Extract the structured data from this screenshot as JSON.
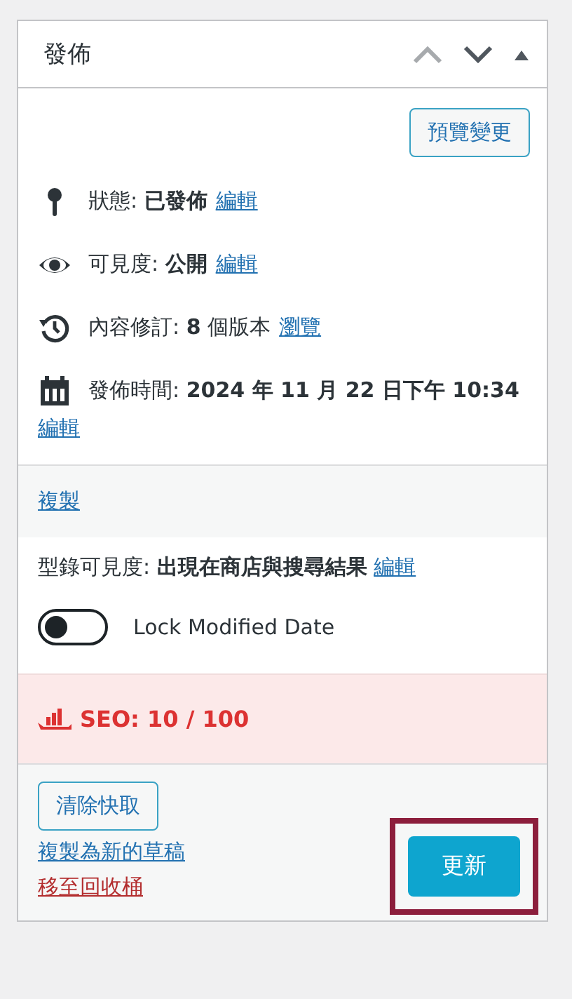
{
  "panel": {
    "title": "發佈"
  },
  "preview_button": "預覽變更",
  "misc": [
    {
      "kind": "status",
      "text": "狀態: **已發佈**",
      "link": "編輯"
    },
    {
      "kind": "visibility",
      "text": "可見度: **公開**",
      "link": "編輯"
    },
    {
      "kind": "revisions",
      "text": "內容修訂: **8** 個版本",
      "link": "瀏覽"
    },
    {
      "kind": "date",
      "text": "發佈時間: **2024 年 11 月 22 日下午 10:34**",
      "link": "編輯"
    }
  ],
  "duplicate_link": "複製",
  "catalog_visibility": {
    "text": "型錄可見度: **出現在商店與搜尋結果**",
    "link": "編輯"
  },
  "lock_toggle": {
    "label": "Lock Modified Date",
    "on": false
  },
  "seo": {
    "text": "SEO: 10 / 100",
    "color": "#dc3232"
  },
  "clear_cache_button": "清除快取",
  "draft_link": "複製為新的草稿",
  "trash_link": "移至回收桶",
  "update_button": {
    "label": "更新",
    "highlighted": true
  }
}
